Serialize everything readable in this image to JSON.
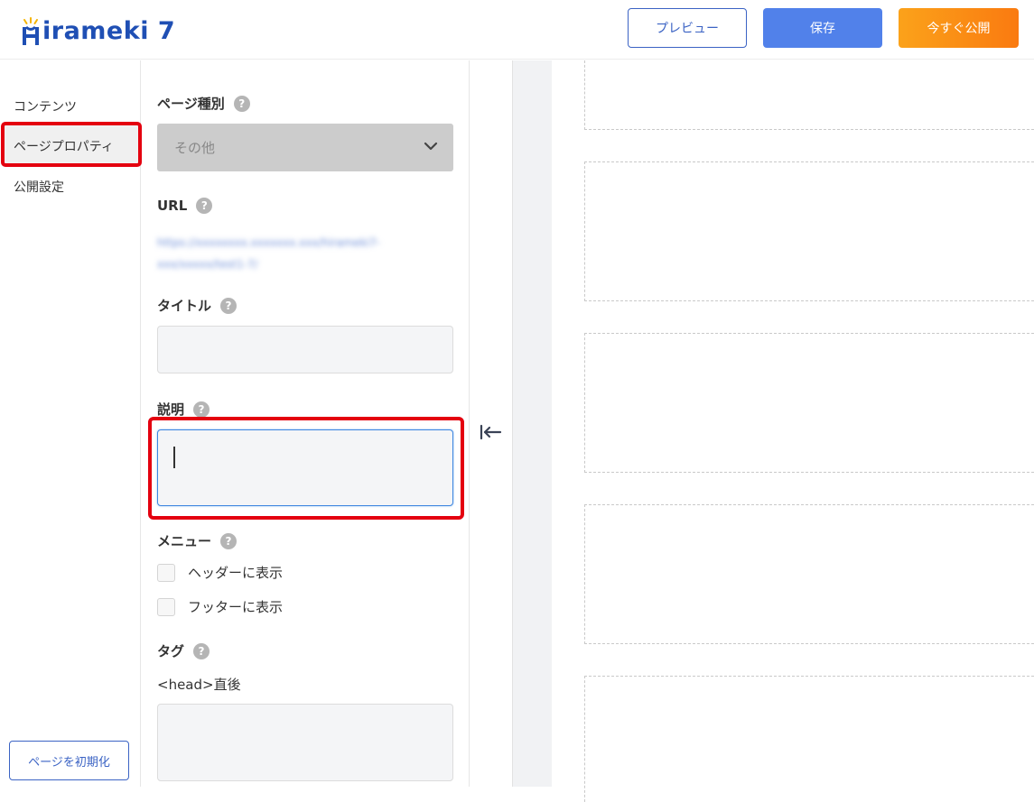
{
  "header": {
    "logo_text": "irameki 7",
    "logo_initial_icon": "h-crown-logo-icon",
    "buttons": {
      "preview": "プレビュー",
      "save": "保存",
      "publish": "今すぐ公開"
    },
    "colors": {
      "brand": "#1f4fb4",
      "save": "#5181ea",
      "publish_from": "#fba21a",
      "publish_to": "#fa7a10"
    }
  },
  "sidebar": {
    "items": [
      {
        "label": "コンテンツ"
      },
      {
        "label": "ページプロパティ",
        "active": true
      },
      {
        "label": "公開設定"
      }
    ],
    "reset_button": "ページを初期化"
  },
  "properties": {
    "page_type": {
      "label": "ページ種別",
      "value": "その他",
      "help_icon": "question-circle-icon"
    },
    "url": {
      "label": "URL",
      "value": "https://xxxxxxxx.xxxxxxx.xxx/hirameki7-xxx/xxxxx/test1-7/"
    },
    "title": {
      "label": "タイトル",
      "value": ""
    },
    "description": {
      "label": "説明",
      "value": ""
    },
    "menu": {
      "label": "メニュー",
      "options": [
        {
          "label": "ヘッダーに表示",
          "checked": false
        },
        {
          "label": "フッターに表示",
          "checked": false
        }
      ]
    },
    "tag": {
      "label": "タグ",
      "sub_label": "<head>直後",
      "value": ""
    }
  },
  "annotation_color": "#e4000f"
}
